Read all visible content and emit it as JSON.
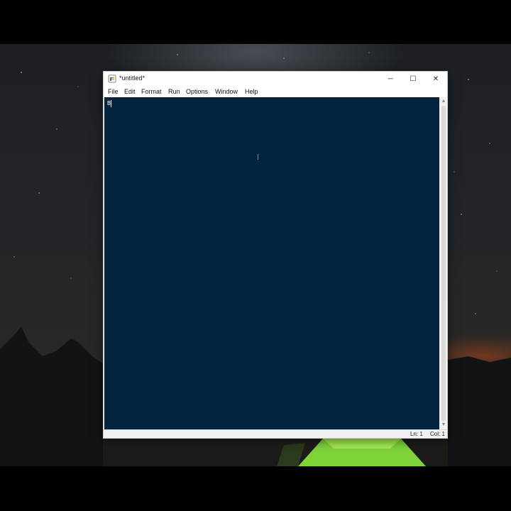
{
  "window": {
    "title": "*untitled*",
    "buttons": {
      "minimize": "─",
      "maximize": "☐",
      "close": "✕"
    }
  },
  "menu": {
    "items": [
      "File",
      "Edit",
      "Format",
      "Run",
      "Options",
      "Window",
      "Help"
    ]
  },
  "editor": {
    "content": "B",
    "background": "#02243f"
  },
  "status": {
    "line": "Ln: 1",
    "col": "Col: 1"
  },
  "icons": {
    "app": "python-idle-icon",
    "scroll_up": "▲",
    "scroll_down": "▼"
  }
}
